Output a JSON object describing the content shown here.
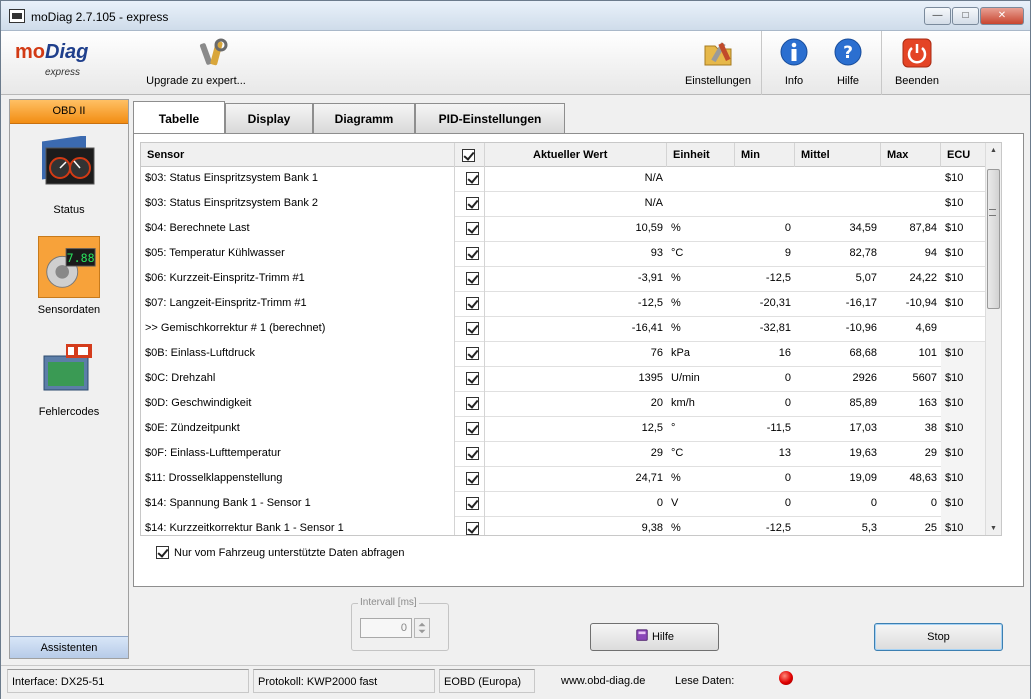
{
  "window": {
    "title": "moDiag 2.7.105 - express"
  },
  "logo": {
    "part1": "mo",
    "part2": "Diag",
    "edition": "express"
  },
  "toolbar": {
    "upgrade": "Upgrade zu expert...",
    "settings": "Einstellungen",
    "info": "Info",
    "help": "Hilfe",
    "quit": "Beenden"
  },
  "sidebar": {
    "header": "OBD II",
    "items": [
      {
        "label": "Status",
        "icon": "status-gauge-icon"
      },
      {
        "label": "Sensordaten",
        "icon": "sensor-data-icon",
        "selected": true
      },
      {
        "label": "Fehlercodes",
        "icon": "error-codes-icon"
      }
    ],
    "assistants": "Assistenten"
  },
  "tabs": [
    {
      "label": "Tabelle",
      "active": true
    },
    {
      "label": "Display"
    },
    {
      "label": "Diagramm"
    },
    {
      "label": "PID-Einstellungen"
    }
  ],
  "table": {
    "columns": {
      "sensor": "Sensor",
      "value": "Aktueller Wert",
      "unit": "Einheit",
      "min": "Min",
      "mean": "Mittel",
      "max": "Max",
      "ecu": "ECU"
    },
    "rows": [
      {
        "sensor": "$03: Status Einspritzsystem Bank 1",
        "value": "N/A",
        "unit": "",
        "min": "",
        "mean": "",
        "max": "",
        "ecu": "$10"
      },
      {
        "sensor": "$03: Status Einspritzsystem Bank 2",
        "value": "N/A",
        "unit": "",
        "min": "",
        "mean": "",
        "max": "",
        "ecu": "$10"
      },
      {
        "sensor": "$04: Berechnete Last",
        "value": "10,59",
        "unit": "%",
        "min": "0",
        "mean": "34,59",
        "max": "87,84",
        "ecu": "$10"
      },
      {
        "sensor": "$05: Temperatur Kühlwasser",
        "value": "93",
        "unit": "°C",
        "min": "9",
        "mean": "82,78",
        "max": "94",
        "ecu": "$10"
      },
      {
        "sensor": "$06: Kurzzeit-Einspritz-Trimm #1",
        "value": "-3,91",
        "unit": "%",
        "min": "-12,5",
        "mean": "5,07",
        "max": "24,22",
        "ecu": "$10"
      },
      {
        "sensor": "$07: Langzeit-Einspritz-Trimm #1",
        "value": "-12,5",
        "unit": "%",
        "min": "-20,31",
        "mean": "-16,17",
        "max": "-10,94",
        "ecu": "$10"
      },
      {
        "sensor": ">> Gemischkorrektur # 1 (berechnet)",
        "value": "-16,41",
        "unit": "%",
        "min": "-32,81",
        "mean": "-10,96",
        "max": "4,69",
        "ecu": ""
      },
      {
        "sensor": "$0B: Einlass-Luftdruck",
        "value": "76",
        "unit": "kPa",
        "min": "16",
        "mean": "68,68",
        "max": "101",
        "ecu": "$10"
      },
      {
        "sensor": "$0C: Drehzahl",
        "value": "1395",
        "unit": "U/min",
        "min": "0",
        "mean": "2926",
        "max": "5607",
        "ecu": "$10"
      },
      {
        "sensor": "$0D: Geschwindigkeit",
        "value": "20",
        "unit": "km/h",
        "min": "0",
        "mean": "85,89",
        "max": "163",
        "ecu": "$10"
      },
      {
        "sensor": "$0E: Zündzeitpunkt",
        "value": "12,5",
        "unit": "°",
        "min": "-11,5",
        "mean": "17,03",
        "max": "38",
        "ecu": "$10"
      },
      {
        "sensor": "$0F: Einlass-Lufttemperatur",
        "value": "29",
        "unit": "°C",
        "min": "13",
        "mean": "19,63",
        "max": "29",
        "ecu": "$10"
      },
      {
        "sensor": "$11: Drosselklappenstellung",
        "value": "24,71",
        "unit": "%",
        "min": "0",
        "mean": "19,09",
        "max": "48,63",
        "ecu": "$10"
      },
      {
        "sensor": "$14: Spannung Bank 1 - Sensor 1",
        "value": "0",
        "unit": "V",
        "min": "0",
        "mean": "0",
        "max": "0",
        "ecu": "$10"
      },
      {
        "sensor": "$14: Kurzzeitkorrektur Bank 1 - Sensor 1",
        "value": "9,38",
        "unit": "%",
        "min": "-12,5",
        "mean": "5,3",
        "max": "25",
        "ecu": "$10"
      }
    ]
  },
  "support_checkbox": "Nur vom Fahrzeug unterstützte Daten abfragen",
  "interval": {
    "label": "Intervall [ms]",
    "value": "0"
  },
  "buttons": {
    "help": "Hilfe",
    "stop": "Stop"
  },
  "status": {
    "interface": "Interface: DX25-51",
    "protocol": "Protokoll: KWP2000 fast",
    "eobd": "EOBD (Europa)",
    "website": "www.obd-diag.de",
    "reading": "Lese Daten:"
  },
  "colors": {
    "accent_orange": "#f28d13",
    "status_led": "#e00000"
  }
}
